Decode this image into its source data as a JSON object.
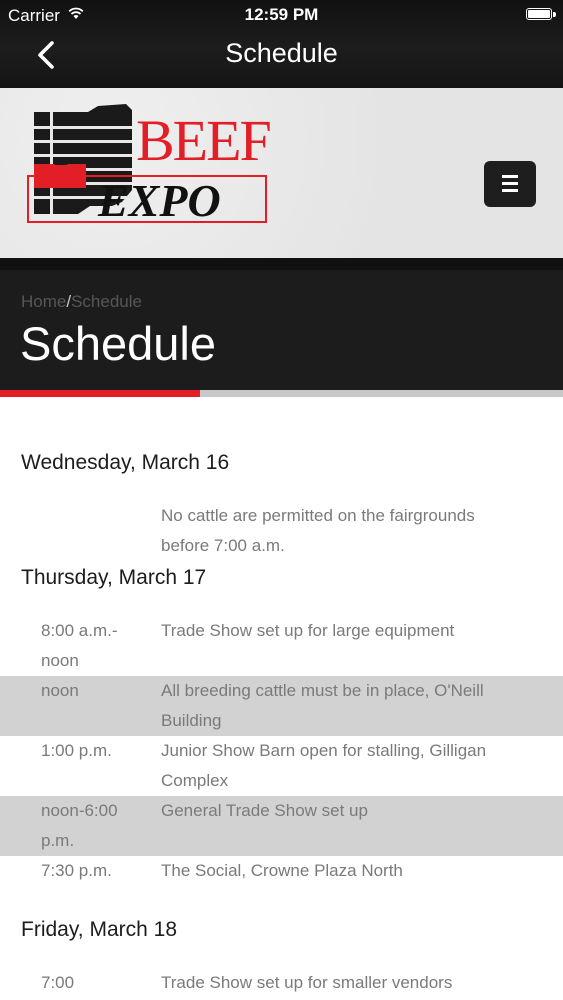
{
  "status_bar": {
    "carrier": "Carrier",
    "time": "12:59 PM"
  },
  "nav": {
    "title": "Schedule"
  },
  "logo": {
    "text_top": "BEEF",
    "text_bottom": "EXPO"
  },
  "breadcrumb": {
    "home": "Home",
    "separator": "/",
    "current": "Schedule"
  },
  "page": {
    "title": "Schedule"
  },
  "schedule": {
    "wednesday": {
      "heading": "Wednesday, March 16",
      "r0": {
        "time": "",
        "line1": "No cattle are permitted on the fairgrounds",
        "line2": "before 7:00 a.m."
      }
    },
    "thursday": {
      "heading": "Thursday, March 17",
      "r0": {
        "time1": "8:00 a.m.-",
        "time2": "noon",
        "line1": "Trade Show set up for large equipment",
        "line2": ""
      },
      "r1": {
        "time1": "noon",
        "time2": "",
        "line1": "All breeding cattle must be in place, O'Neill",
        "line2": "Building"
      },
      "r2": {
        "time1": "1:00 p.m.",
        "time2": "",
        "line1": "Junior Show Barn open for stalling, Gilligan",
        "line2": "Complex"
      },
      "r3": {
        "time1": "noon-6:00",
        "time2": "p.m.",
        "line1": "General Trade Show set up",
        "line2": ""
      },
      "r4": {
        "time1": "7:30 p.m.",
        "time2": "",
        "line1": "The Social, Crowne Plaza North",
        "line2": ""
      }
    },
    "friday": {
      "heading": "Friday, March 18",
      "r0": {
        "time1": "7:00",
        "line1": "Trade Show set up for smaller vendors"
      }
    }
  },
  "colors": {
    "accent": "#e21f26",
    "dark": "#1c1c1c",
    "shade": "#d2d2d2"
  }
}
